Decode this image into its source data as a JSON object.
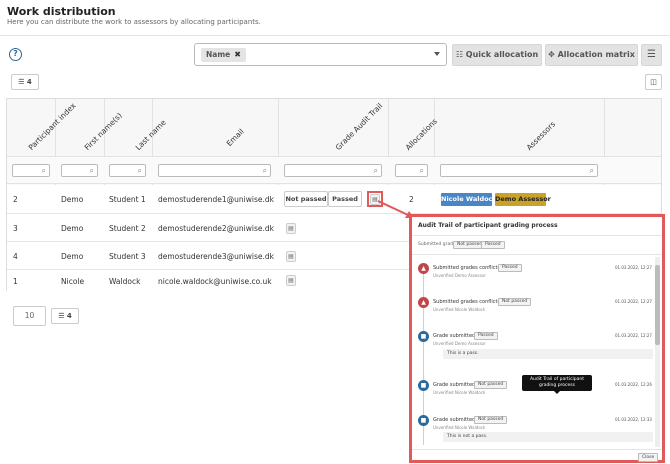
{
  "page": {
    "title": "Work distribution",
    "subtitle": "Here you can distribute the work to assessors by allocating participants."
  },
  "toolbar": {
    "help": "?",
    "filter_chip": "Name",
    "chip_close": "✖",
    "quick_allocation": "Quick allocation",
    "allocation_matrix": "Allocation matrix",
    "columns_count": "4"
  },
  "table": {
    "columns": [
      "Participant index",
      "First name(s)",
      "Last name",
      "Email",
      "Grade Audit Trail",
      "Allocations",
      "Assessors"
    ],
    "rows": [
      {
        "index": "2",
        "first": "Demo",
        "last": "Student 1",
        "email": "demostuderende1@uniwise.dk",
        "grade_buttons": [
          "Not passed",
          "Passed"
        ],
        "allocations": "2",
        "assessors": [
          "Nicole Waldock",
          "Demo Assessor"
        ]
      },
      {
        "index": "3",
        "first": "Demo",
        "last": "Student 2",
        "email": "demostuderende2@uniwise.dk"
      },
      {
        "index": "4",
        "first": "Demo",
        "last": "Student 3",
        "email": "demostuderende3@uniwise.dk"
      },
      {
        "index": "1",
        "first": "Nicole",
        "last": "Waldock",
        "email": "nicole.waldock@uniwise.co.uk"
      }
    ]
  },
  "pagination": {
    "page_size": "10",
    "count": "4"
  },
  "modal": {
    "title": "Audit Trail of participant grading process",
    "submitted_label": "Submitted grades:",
    "submitted_chips": [
      "Not passed",
      "Passed"
    ],
    "events": [
      {
        "title": "Submitted grades conflicted:",
        "chip": "Passed",
        "sub": "Unverified Demo Assessor",
        "time": "01.03.2022, 12:27",
        "kind": "warn"
      },
      {
        "title": "Submitted grades conflicted:",
        "chip": "Not passed",
        "sub": "Unverified Nicole Waldock",
        "time": "01.03.2022, 12:27",
        "kind": "warn"
      },
      {
        "title": "Grade submitted:",
        "chip": "Passed",
        "sub": "Unverified Demo Assessor",
        "time": "01.03.2022, 12:27",
        "kind": "lock",
        "note": "This is a pass."
      },
      {
        "title": "Grade submitted:",
        "chip": "Not passed",
        "sub": "Unverified Nicole Waldock",
        "time": "01.03.2022, 12:26",
        "kind": "lock"
      },
      {
        "title": "Grade submitted:",
        "chip": "Not passed",
        "sub": "Unverified Nicole Waldock",
        "time": "01.03.2022, 12:33",
        "kind": "lock",
        "note": "This is not a pass."
      }
    ],
    "tooltip": "Audit Trail of participant grading process",
    "close": "Close"
  },
  "colors": {
    "accent": "#2c6a9c",
    "assessor_blue": "#4a86c5",
    "assessor_gold": "#c9a227",
    "highlight": "#e05a5a"
  }
}
